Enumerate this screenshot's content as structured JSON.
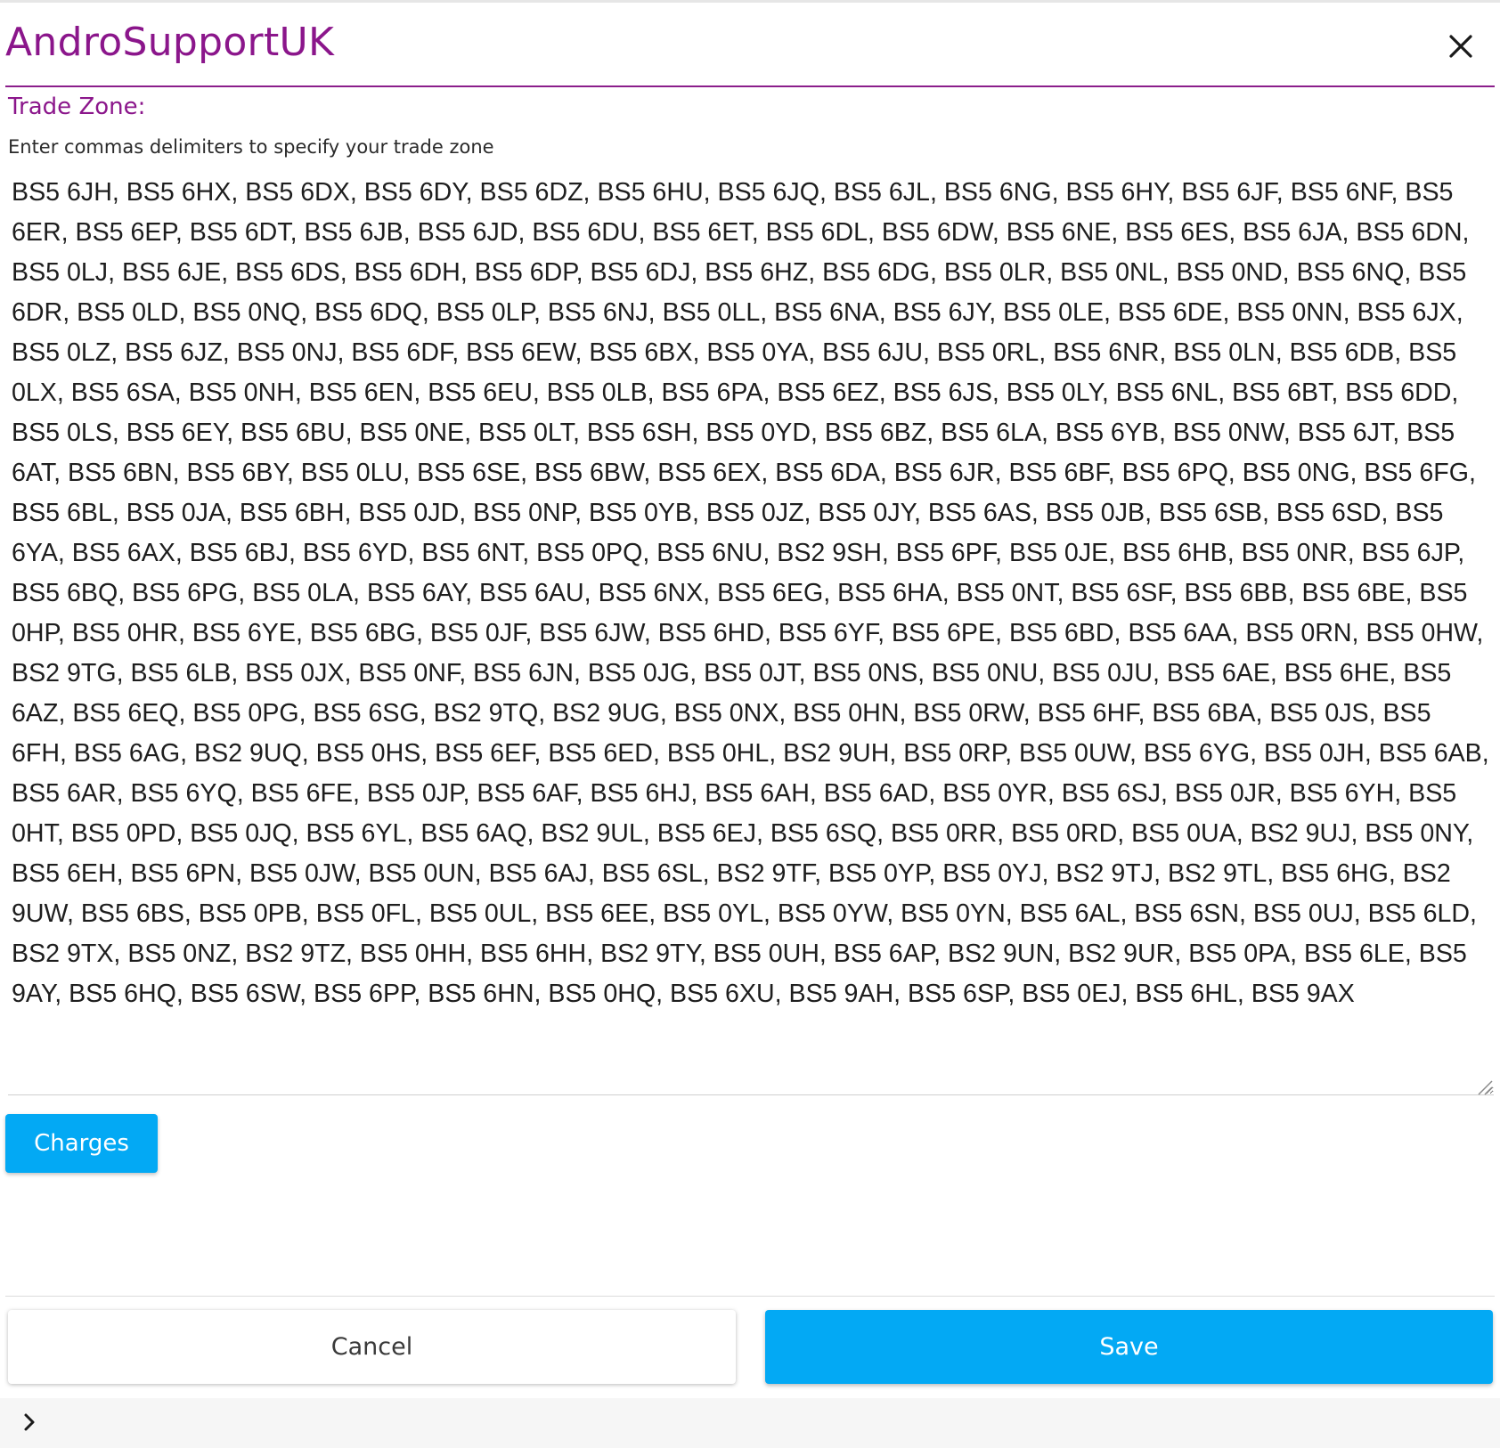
{
  "app": {
    "title": "AndroSupportUK"
  },
  "icons": {
    "close": "close-icon",
    "expand": "chevron-right-icon",
    "resize": "resize-grip-icon"
  },
  "trade_zone": {
    "label": "Trade Zone:",
    "helper": "Enter commas delimiters to specify your trade zone",
    "value": "BS5 6JH, BS5 6HX, BS5 6DX, BS5 6DY, BS5 6DZ, BS5 6HU, BS5 6JQ, BS5 6JL, BS5 6NG, BS5 6HY, BS5 6JF, BS5 6NF, BS5 6ER, BS5 6EP, BS5 6DT, BS5 6JB, BS5 6JD, BS5 6DU, BS5 6ET, BS5 6DL, BS5 6DW, BS5 6NE, BS5 6ES, BS5 6JA, BS5 6DN, BS5 0LJ, BS5 6JE, BS5 6DS, BS5 6DH, BS5 6DP, BS5 6DJ, BS5 6HZ, BS5 6DG, BS5 0LR, BS5 0NL, BS5 0ND, BS5 6NQ, BS5 6DR, BS5 0LD, BS5 0NQ, BS5 6DQ, BS5 0LP, BS5 6NJ, BS5 0LL, BS5 6NA, BS5 6JY, BS5 0LE, BS5 6DE, BS5 0NN, BS5 6JX, BS5 0LZ, BS5 6JZ, BS5 0NJ, BS5 6DF, BS5 6EW, BS5 6BX, BS5 0YA, BS5 6JU, BS5 0RL, BS5 6NR, BS5 0LN, BS5 6DB, BS5 0LX, BS5 6SA, BS5 0NH, BS5 6EN, BS5 6EU, BS5 0LB, BS5 6PA, BS5 6EZ, BS5 6JS, BS5 0LY, BS5 6NL, BS5 6BT, BS5 6DD, BS5 0LS, BS5 6EY, BS5 6BU, BS5 0NE, BS5 0LT, BS5 6SH, BS5 0YD, BS5 6BZ, BS5 6LA, BS5 6YB, BS5 0NW, BS5 6JT, BS5 6AT, BS5 6BN, BS5 6BY, BS5 0LU, BS5 6SE, BS5 6BW, BS5 6EX, BS5 6DA, BS5 6JR, BS5 6BF, BS5 6PQ, BS5 0NG, BS5 6FG, BS5 6BL, BS5 0JA, BS5 6BH, BS5 0JD, BS5 0NP, BS5 0YB, BS5 0JZ, BS5 0JY, BS5 6AS, BS5 0JB, BS5 6SB, BS5 6SD, BS5 6YA, BS5 6AX, BS5 6BJ, BS5 6YD, BS5 6NT, BS5 0PQ, BS5 6NU, BS2 9SH, BS5 6PF, BS5 0JE, BS5 6HB, BS5 0NR, BS5 6JP, BS5 6BQ, BS5 6PG, BS5 0LA, BS5 6AY, BS5 6AU, BS5 6NX, BS5 6EG, BS5 6HA, BS5 0NT, BS5 6SF, BS5 6BB, BS5 6BE, BS5 0HP, BS5 0HR, BS5 6YE, BS5 6BG, BS5 0JF, BS5 6JW, BS5 6HD, BS5 6YF, BS5 6PE, BS5 6BD, BS5 6AA, BS5 0RN, BS5 0HW, BS2 9TG, BS5 6LB, BS5 0JX, BS5 0NF, BS5 6JN, BS5 0JG, BS5 0JT, BS5 0NS, BS5 0NU, BS5 0JU, BS5 6AE, BS5 6HE, BS5 6AZ, BS5 6EQ, BS5 0PG, BS5 6SG, BS2 9TQ, BS2 9UG, BS5 0NX, BS5 0HN, BS5 0RW, BS5 6HF, BS5 6BA, BS5 0JS, BS5 6FH, BS5 6AG, BS2 9UQ, BS5 0HS, BS5 6EF, BS5 6ED, BS5 0HL, BS2 9UH, BS5 0RP, BS5 0UW, BS5 6YG, BS5 0JH, BS5 6AB, BS5 6AR, BS5 6YQ, BS5 6FE, BS5 0JP, BS5 6AF, BS5 6HJ, BS5 6AH, BS5 6AD, BS5 0YR, BS5 6SJ, BS5 0JR, BS5 6YH, BS5 0HT, BS5 0PD, BS5 0JQ, BS5 6YL, BS5 6AQ, BS2 9UL, BS5 6EJ, BS5 6SQ, BS5 0RR, BS5 0RD, BS5 0UA, BS2 9UJ, BS5 0NY, BS5 6EH, BS5 6PN, BS5 0JW, BS5 0UN, BS5 6AJ, BS5 6SL, BS2 9TF, BS5 0YP, BS5 0YJ, BS2 9TJ, BS2 9TL, BS5 6HG, BS2 9UW, BS5 6BS, BS5 0PB, BS5 0FL, BS5 0UL, BS5 6EE, BS5 0YL, BS5 0YW, BS5 0YN, BS5 6AL, BS5 6SN, BS5 0UJ, BS5 6LD, BS2 9TX, BS5 0NZ, BS2 9TZ, BS5 0HH, BS5 6HH, BS2 9TY, BS5 0UH, BS5 6AP, BS2 9UN, BS2 9UR, BS5 0PA, BS5 6LE, BS5 9AY, BS5 6HQ, BS5 6SW, BS5 6PP, BS5 6HN, BS5 0HQ, BS5 6XU, BS5 9AH, BS5 6SP, BS5 0EJ, BS5 6HL, BS5 9AX"
  },
  "buttons": {
    "charges": "Charges",
    "cancel": "Cancel",
    "save": "Save"
  },
  "colors": {
    "brand_purple": "#8b168b",
    "accent_blue": "#03a9f4"
  }
}
